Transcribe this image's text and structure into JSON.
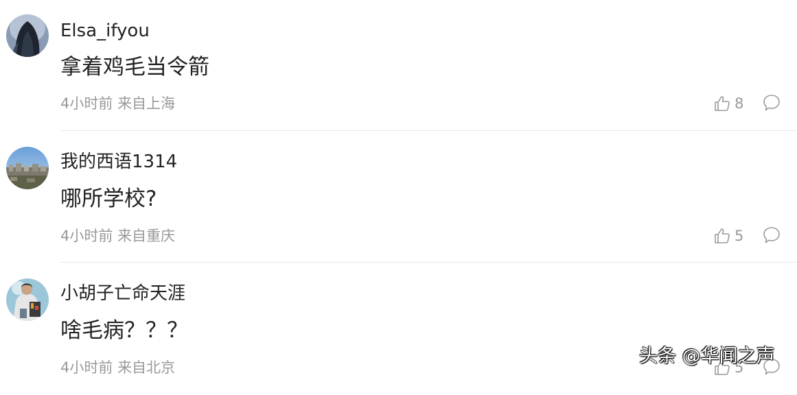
{
  "comments": [
    {
      "username": "Elsa_ifyou",
      "content": "拿着鸡毛当令箭",
      "time": "4小时前",
      "location": "来自上海",
      "likes": "8"
    },
    {
      "username": "我的西语1314",
      "content": "哪所学校?",
      "time": "4小时前",
      "location": "来自重庆",
      "likes": "5"
    },
    {
      "username": "小胡子亡命天涯",
      "content": "啥毛病？？？",
      "time": "4小时前",
      "location": "来自北京",
      "likes": "5"
    }
  ],
  "watermark": "头条 @华闻之声",
  "icons": {
    "like": "thumbs-up-icon",
    "reply": "speech-bubble-icon"
  },
  "colors": {
    "text": "#222222",
    "meta": "#999999",
    "divider": "#e8e8e8"
  }
}
